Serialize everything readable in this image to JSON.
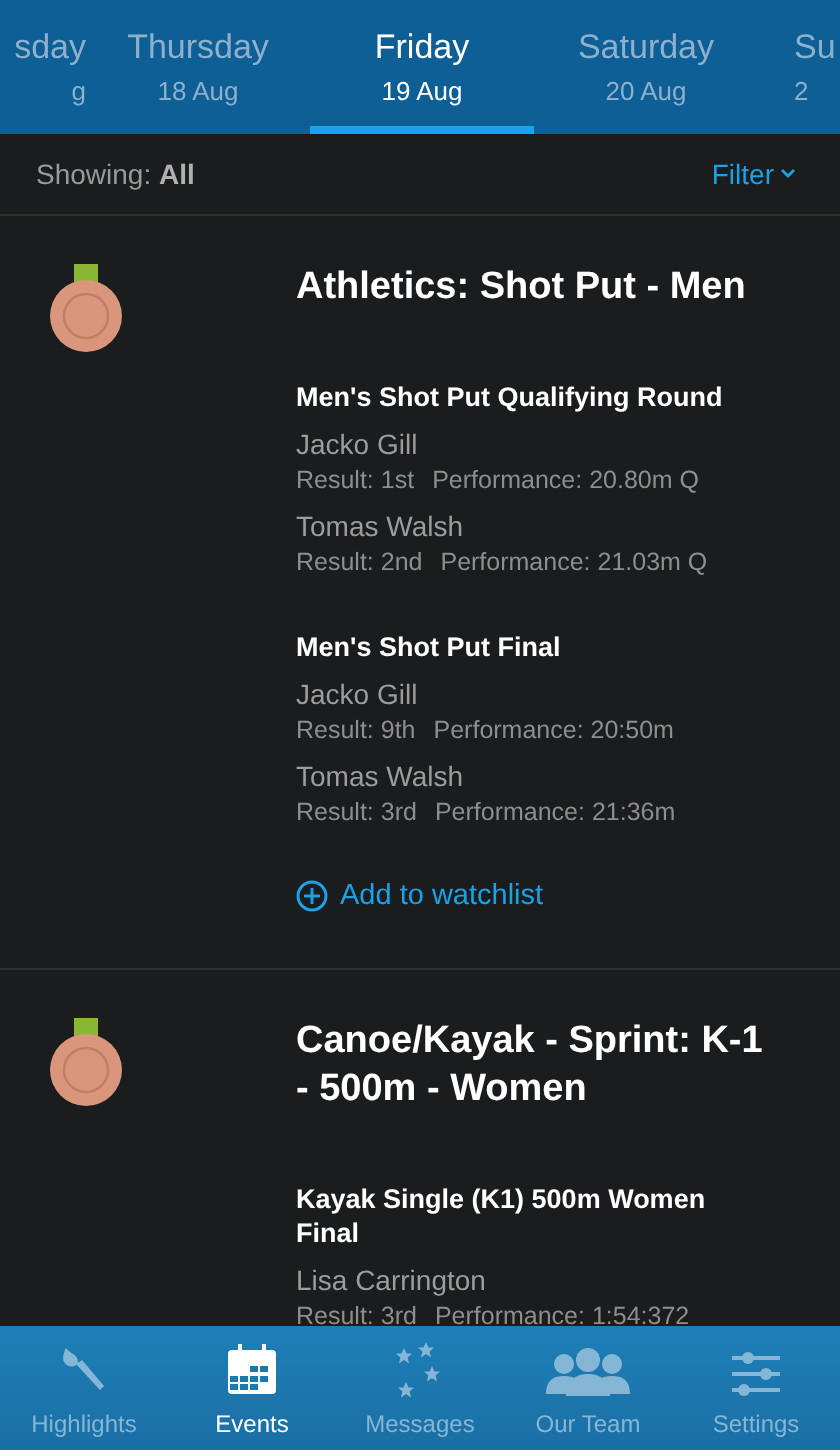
{
  "day_tabs": [
    {
      "day": "sday",
      "date": "g",
      "selected": false
    },
    {
      "day": "Thursday",
      "date": "18 Aug",
      "selected": false
    },
    {
      "day": "Friday",
      "date": "19 Aug",
      "selected": true
    },
    {
      "day": "Saturday",
      "date": "20 Aug",
      "selected": false
    },
    {
      "day": "Su",
      "date": "2",
      "selected": false
    }
  ],
  "filter_bar": {
    "showing_label": "Showing:",
    "showing_value": "All",
    "filter": "Filter"
  },
  "events": [
    {
      "title": "Athletics: Shot Put - Men",
      "watchlist": "Add to watchlist",
      "rounds": [
        {
          "name": "Men's Shot Put Qualifying Round",
          "athletes": [
            {
              "name": "Jacko Gill",
              "result": "Result: 1st",
              "performance": "Performance: 20.80m Q"
            },
            {
              "name": "Tomas Walsh",
              "result": "Result: 2nd",
              "performance": "Performance: 21.03m Q"
            }
          ]
        },
        {
          "name": "Men's Shot Put Final",
          "athletes": [
            {
              "name": "Jacko Gill",
              "result": "Result: 9th",
              "performance": "Performance: 20:50m"
            },
            {
              "name": "Tomas Walsh",
              "result": "Result: 3rd",
              "performance": "Performance: 21:36m"
            }
          ]
        }
      ]
    },
    {
      "title": "Canoe/Kayak - Sprint: K-1 - 500m - Women",
      "rounds": [
        {
          "name": "Kayak Single (K1) 500m Women Final",
          "athletes": [
            {
              "name": "Lisa Carrington",
              "result": "Result: 3rd",
              "performance": "Performance: 1:54:372"
            }
          ]
        }
      ]
    }
  ],
  "tab_bar": [
    {
      "kind": "highlights",
      "label": "Highlights",
      "selected": false
    },
    {
      "kind": "events",
      "label": "Events",
      "selected": true
    },
    {
      "kind": "messages",
      "label": "Messages",
      "selected": false
    },
    {
      "kind": "team",
      "label": "Our Team",
      "selected": false
    },
    {
      "kind": "settings",
      "label": "Settings",
      "selected": false
    }
  ]
}
